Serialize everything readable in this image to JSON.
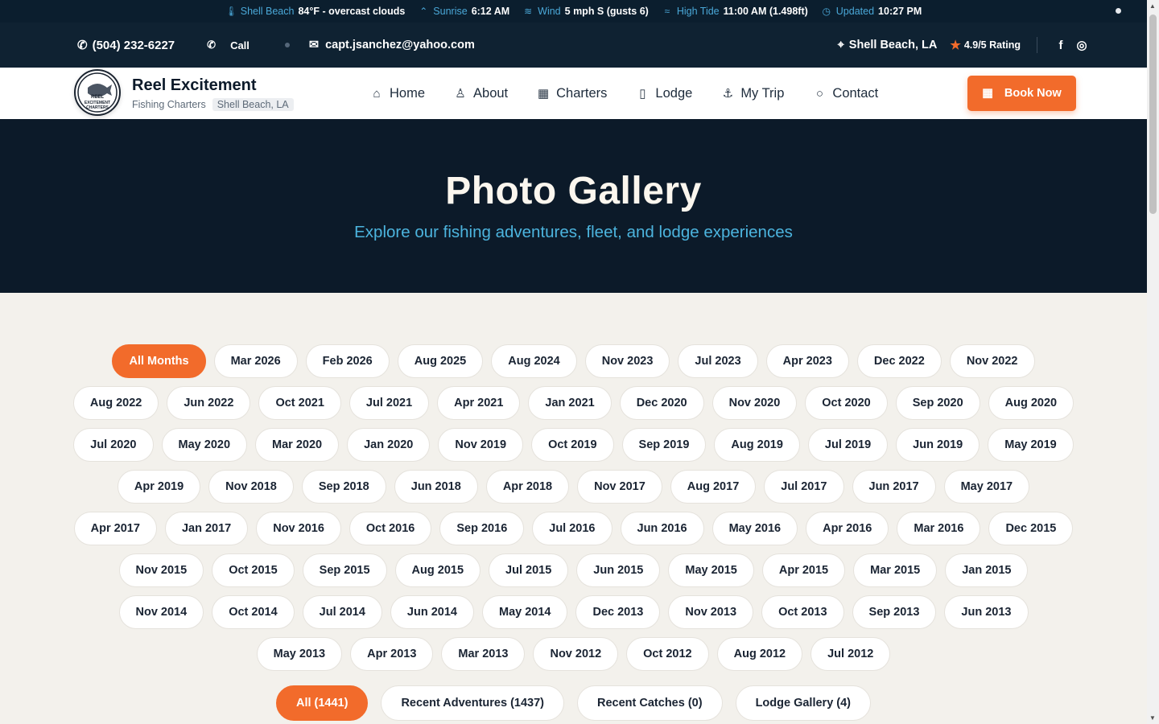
{
  "ticker": {
    "location_label": "Shell Beach",
    "weather": "84°F - overcast clouds",
    "sunrise_label": "Sunrise",
    "sunrise": "6:12 AM",
    "wind_label": "Wind",
    "wind": "5 mph S (gusts 6)",
    "tide_label": "High Tide",
    "tide": "11:00 AM (1.498ft)",
    "updated_label": "Updated",
    "updated": "10:27 PM"
  },
  "contact": {
    "phone": "(504) 232-6227",
    "call_label": "Call",
    "email": "capt.jsanchez@yahoo.com",
    "location": "Shell Beach, LA",
    "rating": "4.9/5 Rating"
  },
  "brand": {
    "logo_text": "REEL EXCITEMENT CHARTERS",
    "title": "Reel Excitement",
    "subtitle": "Fishing Charters",
    "pill": "Shell Beach, LA"
  },
  "menu": [
    {
      "label": "Home",
      "icon": "home-icon"
    },
    {
      "label": "About",
      "icon": "user-icon"
    },
    {
      "label": "Charters",
      "icon": "calendar-icon"
    },
    {
      "label": "Lodge",
      "icon": "building-icon"
    },
    {
      "label": "My Trip",
      "icon": "anchor-icon"
    },
    {
      "label": "Contact",
      "icon": "chat-icon"
    }
  ],
  "book_label": "Book Now",
  "hero": {
    "title": "Photo Gallery",
    "subtitle": "Explore our fishing adventures, fleet, and lodge experiences"
  },
  "months": [
    "All Months",
    "Mar 2026",
    "Feb 2026",
    "Aug 2025",
    "Aug 2024",
    "Nov 2023",
    "Jul 2023",
    "Apr 2023",
    "Dec 2022",
    "Nov 2022",
    "Aug 2022",
    "Jun 2022",
    "Oct 2021",
    "Jul 2021",
    "Apr 2021",
    "Jan 2021",
    "Dec 2020",
    "Nov 2020",
    "Oct 2020",
    "Sep 2020",
    "Aug 2020",
    "Jul 2020",
    "May 2020",
    "Mar 2020",
    "Jan 2020",
    "Nov 2019",
    "Oct 2019",
    "Sep 2019",
    "Aug 2019",
    "Jul 2019",
    "Jun 2019",
    "May 2019",
    "Apr 2019",
    "Nov 2018",
    "Sep 2018",
    "Jun 2018",
    "Apr 2018",
    "Nov 2017",
    "Aug 2017",
    "Jul 2017",
    "Jun 2017",
    "May 2017",
    "Apr 2017",
    "Jan 2017",
    "Nov 2016",
    "Oct 2016",
    "Sep 2016",
    "Jul 2016",
    "Jun 2016",
    "May 2016",
    "Apr 2016",
    "Mar 2016",
    "Dec 2015",
    "Nov 2015",
    "Oct 2015",
    "Sep 2015",
    "Aug 2015",
    "Jul 2015",
    "Jun 2015",
    "May 2015",
    "Apr 2015",
    "Mar 2015",
    "Jan 2015",
    "Nov 2014",
    "Oct 2014",
    "Jul 2014",
    "Jun 2014",
    "May 2014",
    "Dec 2013",
    "Nov 2013",
    "Oct 2013",
    "Sep 2013",
    "Jun 2013",
    "May 2013",
    "Apr 2013",
    "Mar 2013",
    "Nov 2012",
    "Oct 2012",
    "Aug 2012",
    "Jul 2012"
  ],
  "active_month": "All Months",
  "categories": [
    "All (1441)",
    "Recent Adventures (1437)",
    "Recent Catches (0)",
    "Lodge Gallery (4)"
  ],
  "active_category": "All (1441)",
  "colors": {
    "accent": "#f26b2b",
    "dark": "#0c1a29",
    "link": "#4cb4de"
  }
}
